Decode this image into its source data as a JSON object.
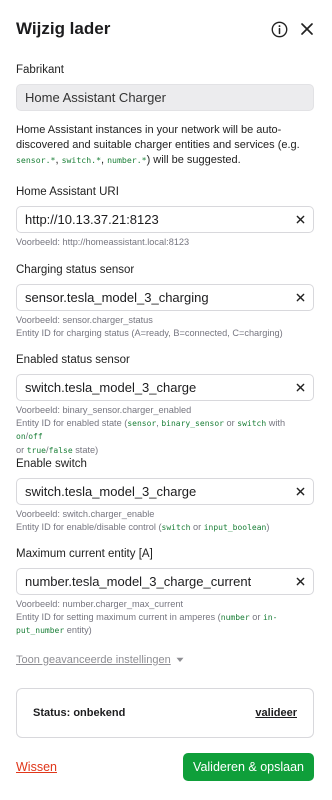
{
  "dialog": {
    "title": "Wijzig lader"
  },
  "manufacturer": {
    "label": "Fabrikant",
    "value": "Home Assistant Charger"
  },
  "intro": {
    "text1": "Home Assistant instances in your network will be auto-discovered and suitable charger entities and services (e.g. ",
    "code1": "sensor.*",
    "sep1": ", ",
    "code2": "switch.*",
    "sep2": ", ",
    "code3": "number.*",
    "text2": ") will be suggested."
  },
  "uri": {
    "label": "Home Assistant URI",
    "value": "http://10.13.37.21:8123",
    "example": "Voorbeeld: http://homeassistant.local:8123"
  },
  "charging_status": {
    "label": "Charging status sensor",
    "value": "sensor.tesla_model_3_charging",
    "example": "Voorbeeld: sensor.charger_status",
    "help": "Entity ID for charging status (A=ready, B=connected, C=charging)"
  },
  "enabled_status": {
    "label": "Enabled status sensor",
    "value": "switch.tesla_model_3_charge",
    "example": "Voorbeeld: binary_sensor.charger_enabled",
    "help1": "Entity ID for enabled state (",
    "c1": "sensor",
    "s1": ", ",
    "c2": "binary_sensor",
    "s2": " or ",
    "c3": "switch",
    "s3": " with ",
    "c4": "on",
    "s4": "/",
    "c5": "off",
    "help2": "or ",
    "c6": "true",
    "s5": "/",
    "c7": "false",
    "help3": " state)"
  },
  "enable_switch": {
    "label": "Enable switch",
    "value": "switch.tesla_model_3_charge",
    "example": "Voorbeeld: switch.charger_enable",
    "help1": "Entity ID for enable/disable control (",
    "c1": "switch",
    "s1": " or ",
    "c2": "input_boolean",
    "help2": ")"
  },
  "max_current": {
    "label": "Maximum current entity [A]",
    "value": "number.tesla_model_3_charge_current",
    "example": "Voorbeeld: number.charger_max_current",
    "help1": "Entity ID for setting maximum current in amperes (",
    "c1": "number",
    "s1": " or ",
    "c2": "in-",
    "c3": "put_number",
    "help2": " entity)"
  },
  "advanced": {
    "label": "Toon geavanceerde instellingen"
  },
  "status": {
    "text": "Status: onbekend",
    "validate": "valideer"
  },
  "footer": {
    "clear": "Wissen",
    "save": "Valideren & opslaan"
  },
  "icons": {
    "info": "info-icon",
    "close": "close-icon",
    "clear": "clear-icon",
    "chevron": "chevron-down-icon"
  },
  "colors": {
    "accent": "#0f9f3a",
    "danger": "#e0361a",
    "code": "#1a7f37"
  }
}
